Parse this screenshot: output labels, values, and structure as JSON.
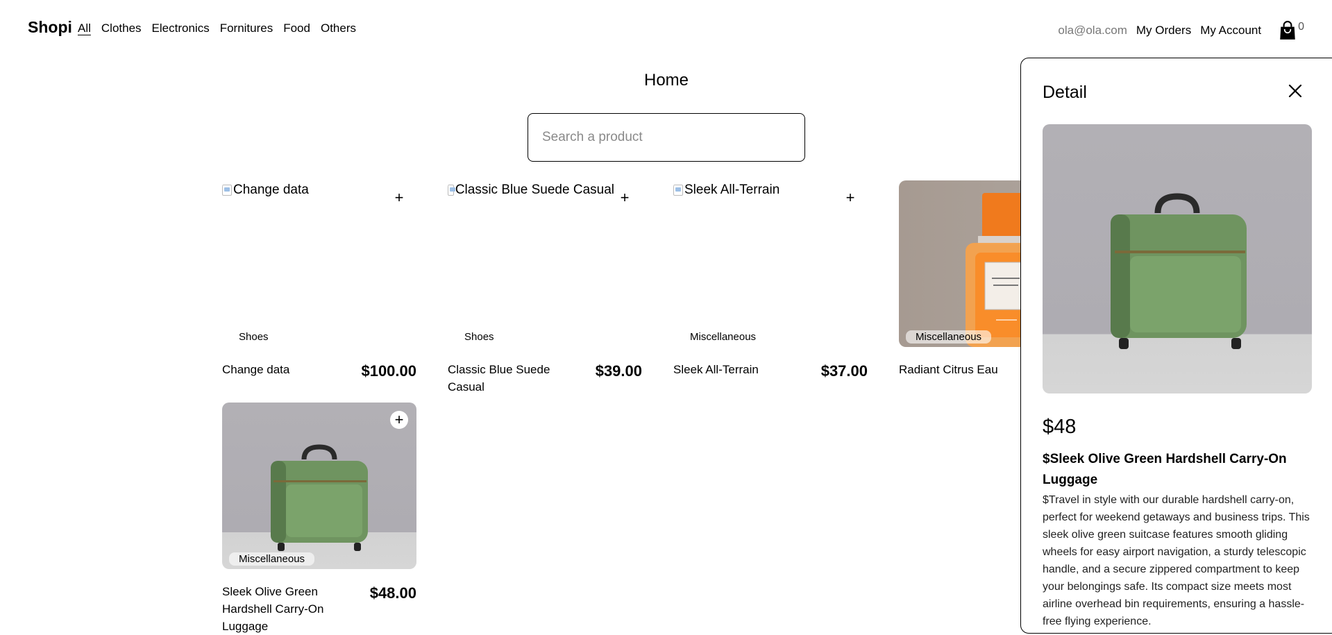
{
  "nav": {
    "brand": "Shopi",
    "categories": [
      "All",
      "Clothes",
      "Electronics",
      "Fornitures",
      "Food",
      "Others"
    ],
    "email": "ola@ola.com",
    "my_orders": "My Orders",
    "my_account": "My Account",
    "cart_count": "0"
  },
  "main": {
    "title": "Home",
    "search_placeholder": "Search a product"
  },
  "products": [
    {
      "alt": "Change data",
      "category": "Shoes",
      "name": "Change data",
      "price": "$100.00",
      "add": "+"
    },
    {
      "alt": "Classic Blue Suede Casual",
      "category": "Shoes",
      "name": "Classic Blue Suede Casual",
      "price": "$39.00",
      "add": "+"
    },
    {
      "alt": "Sleek All-Terrain",
      "category": "Miscellaneous",
      "name": "Sleek All-Terrain",
      "price": "$37.00",
      "add": "+"
    },
    {
      "category": "Miscellaneous",
      "name": "Radiant Citrus Eau",
      "add": "+"
    },
    {
      "category": "Miscellaneous",
      "name": "Sleek Olive Green Hardshell Carry-On Luggage",
      "price": "$48.00",
      "add": "+"
    }
  ],
  "detail": {
    "title": "Detail",
    "price": "$48",
    "name": "$Sleek Olive Green Hardshell Carry-On Luggage",
    "description": "$Travel in style with our durable hardshell carry-on, perfect for weekend getaways and business trips. This sleek olive green suitcase features smooth gliding wheels for easy airport navigation, a sturdy telescopic handle, and a secure zippered compartment to keep your belongings safe. Its compact size meets most airline overhead bin requirements, ensuring a hassle-free flying experience."
  }
}
